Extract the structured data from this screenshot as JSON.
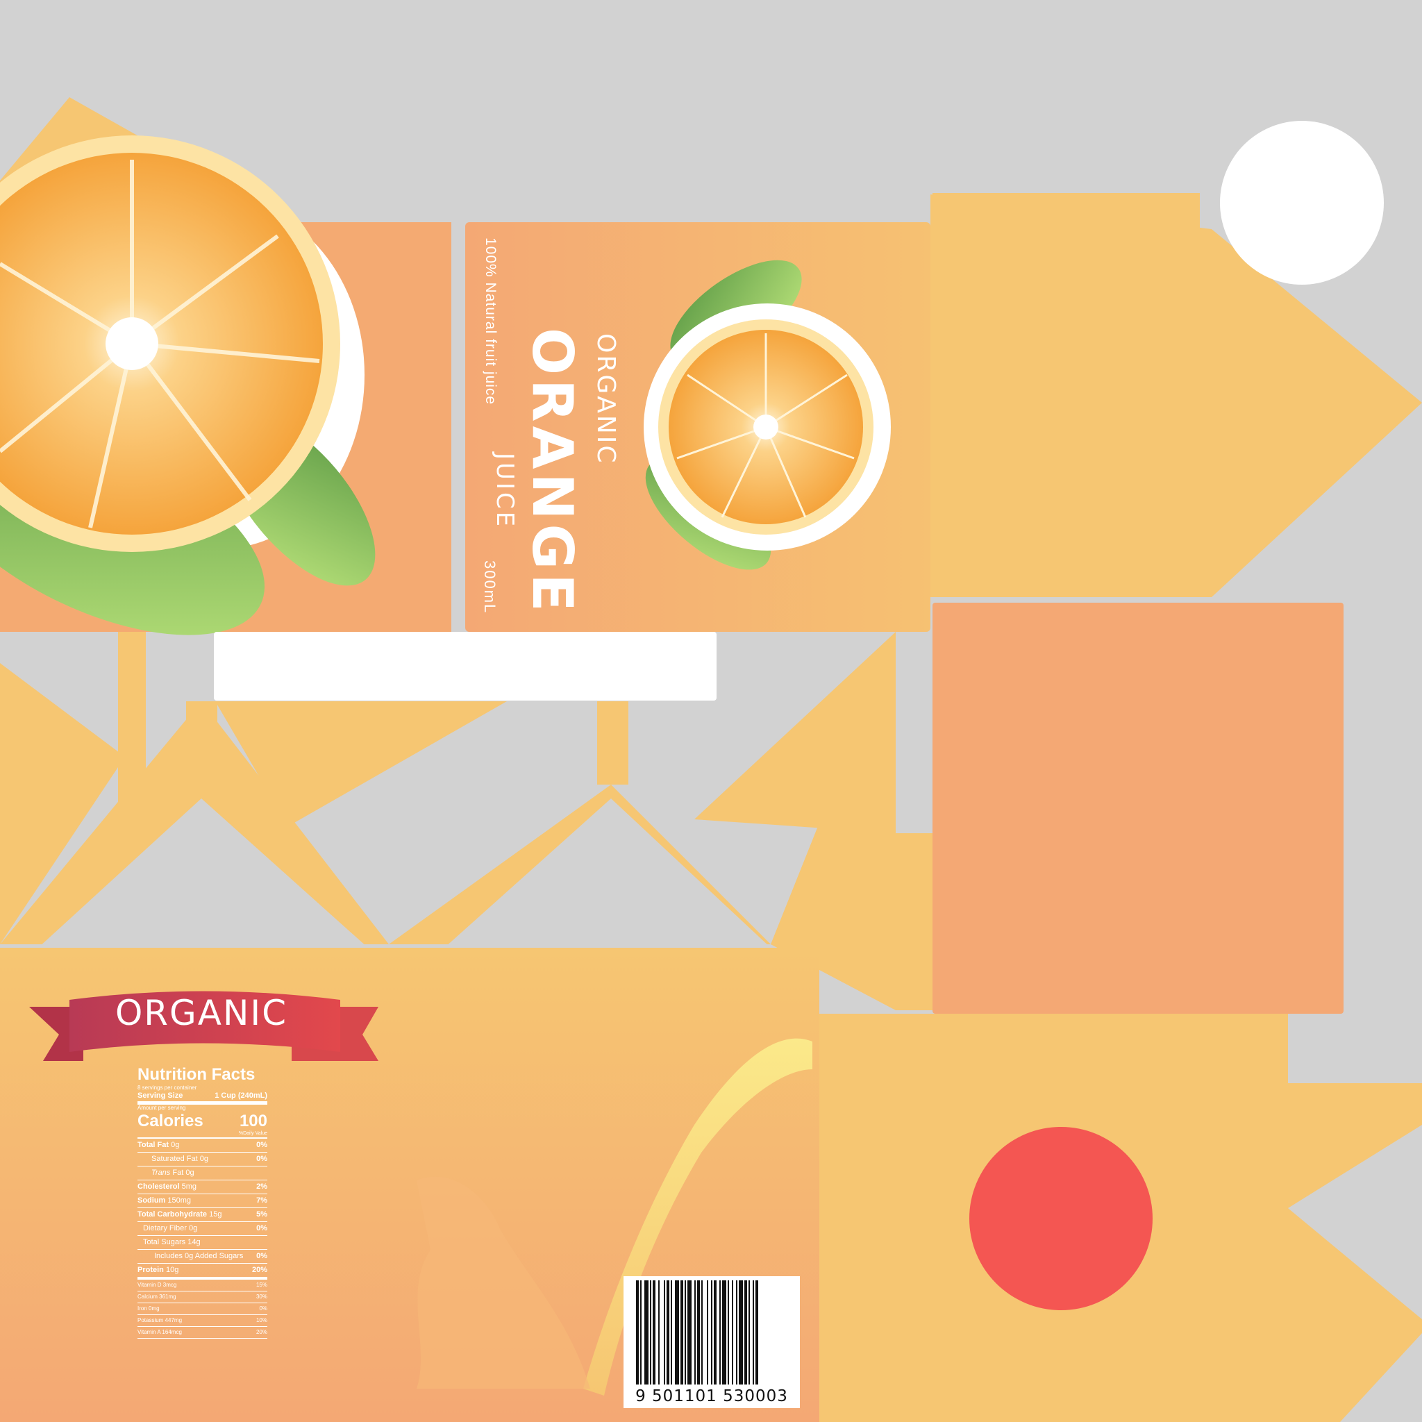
{
  "front": {
    "subtitle": "100% Natural fruit juice",
    "brand": "ORGANIC",
    "name": "ORANGE",
    "kind": "JUICE",
    "volume": "300mL"
  },
  "back": {
    "ribbon": "ORGANIC",
    "nutrition": {
      "title": "Nutrition Facts",
      "servings": "8 servings per container",
      "serving_label": "Serving Size",
      "serving_value": "1 Cup (240mL)",
      "amount_label": "Amount per serving",
      "calories_label": "Calories",
      "calories_value": "100",
      "daily_value": "%Daily Value",
      "rows": [
        {
          "name": "Total Fat",
          "amount": "0g",
          "pct": "0%"
        },
        {
          "name": "Saturated Fat",
          "amount": "0g",
          "pct": "0%"
        },
        {
          "name": "Trans",
          "amount": "Fat 0g",
          "pct": ""
        },
        {
          "name": "Cholesterol",
          "amount": "5mg",
          "pct": "2%"
        },
        {
          "name": "Sodium",
          "amount": "150mg",
          "pct": "7%"
        },
        {
          "name": "Total Carbohydrate",
          "amount": "15g",
          "pct": "5%"
        },
        {
          "name": "Dietary Fiber",
          "amount": "0g",
          "pct": "0%"
        },
        {
          "name": "Total Sugars",
          "amount": "14g",
          "pct": ""
        },
        {
          "name": "Includes 0g Added Sugars",
          "amount": "",
          "pct": "0%"
        },
        {
          "name": "Protein",
          "amount": "10g",
          "pct": "20%"
        }
      ],
      "vitamins": [
        {
          "name": "Vitamin D 3mcg",
          "pct": "15%"
        },
        {
          "name": "Calcium 361mg",
          "pct": "30%"
        },
        {
          "name": "Iron 0mg",
          "pct": "0%"
        },
        {
          "name": "Potassium 447mg",
          "pct": "10%"
        },
        {
          "name": "Vitamin A 164mcg",
          "pct": "20%"
        }
      ]
    },
    "barcode_number": "9 501101 530003"
  },
  "colors": {
    "background": "#d2d2d2",
    "carton_yellow": "#f6c672",
    "carton_peach": "#f4a874",
    "ribbon_red": "#c8434f",
    "cap_red": "#f45652",
    "leaf_green": "#6fae4f"
  }
}
